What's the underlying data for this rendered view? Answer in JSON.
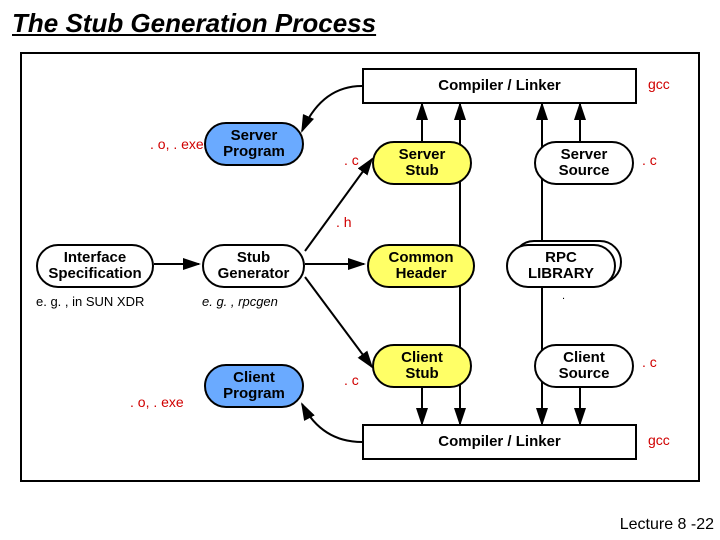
{
  "title": "The Stub Generation Process",
  "nodes": {
    "compiler_top": "Compiler / Linker",
    "server_program": "Server\nProgram",
    "server_stub": "Server\nStub",
    "server_source": "Server\nSource",
    "interface_spec": "Interface\nSpecification",
    "stub_generator": "Stub\nGenerator",
    "common_header": "Common\nHeader",
    "rpc_library": "RPC\nLIBRARY",
    "client_program": "Client\nProgram",
    "client_stub": "Client\nStub",
    "client_source": "Client\nSource",
    "compiler_bottom": "Compiler / Linker"
  },
  "labels": {
    "gcc_top": "gcc",
    "gcc_bottom": "gcc",
    "o_exe_top": ". o, . exe",
    "o_exe_bottom": ". o, . exe",
    "c_server_stub": ". c",
    "c_server_source": ". c",
    "h_common": ". h",
    "c_client_stub": ". c",
    "c_client_source": ". c",
    "eg_xdr": "e. g. , in SUN XDR",
    "eg_rpcgen": "e. g. , rpcgen",
    "rpc_sub": "."
  },
  "footer": "Lecture 8 -22",
  "chart_data": {
    "type": "diagram",
    "title": "The Stub Generation Process",
    "nodes": [
      {
        "id": "interface_spec",
        "label": "Interface Specification",
        "kind": "source",
        "note": "e.g., in SUN XDR"
      },
      {
        "id": "stub_generator",
        "label": "Stub Generator",
        "kind": "tool",
        "note": "e.g., rpcgen"
      },
      {
        "id": "common_header",
        "label": "Common Header",
        "ext": ".h"
      },
      {
        "id": "server_stub",
        "label": "Server Stub",
        "ext": ".c"
      },
      {
        "id": "client_stub",
        "label": "Client Stub",
        "ext": ".c"
      },
      {
        "id": "server_source",
        "label": "Server Source",
        "ext": ".c"
      },
      {
        "id": "client_source",
        "label": "Client Source",
        "ext": ".c"
      },
      {
        "id": "rpc_library",
        "label": "RPC LIBRARY"
      },
      {
        "id": "compiler_top",
        "label": "Compiler / Linker",
        "note": "gcc"
      },
      {
        "id": "compiler_bottom",
        "label": "Compiler / Linker",
        "note": "gcc"
      },
      {
        "id": "server_program",
        "label": "Server Program",
        "ext": ".o, .exe"
      },
      {
        "id": "client_program",
        "label": "Client Program",
        "ext": ".o, .exe"
      }
    ],
    "edges": [
      {
        "from": "interface_spec",
        "to": "stub_generator"
      },
      {
        "from": "stub_generator",
        "to": "server_stub"
      },
      {
        "from": "stub_generator",
        "to": "common_header"
      },
      {
        "from": "stub_generator",
        "to": "client_stub"
      },
      {
        "from": "server_stub",
        "to": "compiler_top"
      },
      {
        "from": "server_source",
        "to": "compiler_top"
      },
      {
        "from": "common_header",
        "to": "compiler_top"
      },
      {
        "from": "rpc_library",
        "to": "compiler_top"
      },
      {
        "from": "compiler_top",
        "to": "server_program"
      },
      {
        "from": "client_stub",
        "to": "compiler_bottom"
      },
      {
        "from": "client_source",
        "to": "compiler_bottom"
      },
      {
        "from": "common_header",
        "to": "compiler_bottom"
      },
      {
        "from": "rpc_library",
        "to": "compiler_bottom"
      },
      {
        "from": "compiler_bottom",
        "to": "client_program"
      }
    ]
  }
}
